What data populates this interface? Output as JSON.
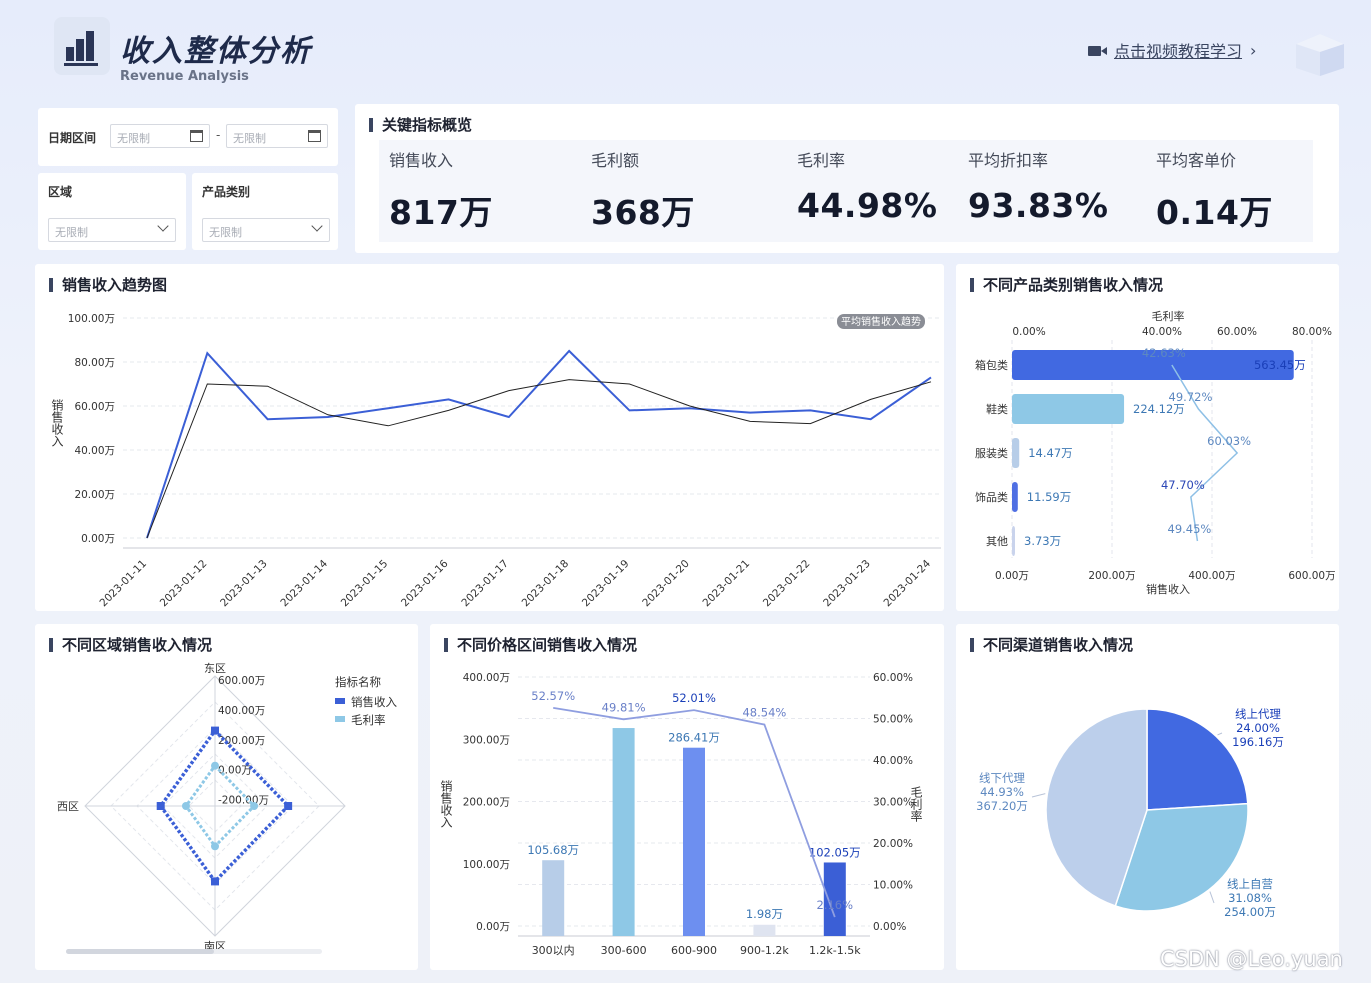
{
  "header": {
    "title": "收入整体分析",
    "subtitle": "Revenue Analysis",
    "tutorial_link": "点击视频教程学习",
    "watermark": "CSDN @Leo.yuan"
  },
  "filters": {
    "date_label": "日期区间",
    "date_start_placeholder": "无限制",
    "date_sep": "-",
    "date_end_placeholder": "无限制",
    "region_label": "区域",
    "region_value": "无限制",
    "category_label": "产品类别",
    "category_value": "无限制"
  },
  "kpi": {
    "title": "关键指标概览",
    "items": [
      {
        "label": "销售收入",
        "value": "817万"
      },
      {
        "label": "毛利额",
        "value": "368万"
      },
      {
        "label": "毛利率",
        "value": "44.98%"
      },
      {
        "label": "平均折扣率",
        "value": "93.83%"
      },
      {
        "label": "平均客单价",
        "value": "0.14万"
      }
    ]
  },
  "panels": {
    "trend_title": "销售收入趋势图",
    "category_title": "不同产品类别销售收入情况",
    "region_title": "不同区域销售收入情况",
    "price_title": "不同价格区间销售收入情况",
    "channel_title": "不同渠道销售收入情况"
  },
  "chart_data": [
    {
      "type": "line",
      "ylabel": "销售收入",
      "ylim": [
        0,
        100
      ],
      "y_ticks": [
        "0.00万",
        "20.00万",
        "40.00万",
        "60.00万",
        "80.00万",
        "100.00万"
      ],
      "x": [
        "2023-01-11",
        "2023-01-12",
        "2023-01-13",
        "2023-01-14",
        "2023-01-15",
        "2023-01-16",
        "2023-01-17",
        "2023-01-18",
        "2023-01-19",
        "2023-01-20",
        "2023-01-21",
        "2023-01-22",
        "2023-01-23",
        "2023-01-24"
      ],
      "series": [
        {
          "values": [
            0,
            84,
            54,
            55,
            59,
            63,
            55,
            85,
            58,
            59,
            57,
            58,
            54,
            73
          ],
          "color": "#3b5fd6"
        },
        {
          "values": [
            0,
            70,
            69,
            56,
            51,
            58,
            67,
            72,
            70,
            60,
            53,
            52,
            63,
            71
          ],
          "color": "#222222"
        }
      ],
      "badge": "平均销售收入趋势",
      "grid": true
    },
    {
      "type": "bar",
      "orientation": "horizontal",
      "categories": [
        "箱包类",
        "鞋类",
        "服装类",
        "饰品类",
        "其他"
      ],
      "bar_labels": [
        "563.45万",
        "224.12万",
        "14.47万",
        "11.59万",
        "3.73万"
      ],
      "values": [
        563.45,
        224.12,
        14.47,
        11.59,
        3.73
      ],
      "bar_colors": [
        "#4169e1",
        "#8ec8e6",
        "#b7cde8",
        "#4f6fe3",
        "#c9d3ec"
      ],
      "xlabel": "销售收入",
      "x_ticks": [
        "0.00万",
        "200.00万",
        "400.00万",
        "600.00万"
      ],
      "xlim": [
        0,
        600
      ],
      "secondary_label": "毛利率",
      "secondary_ticks": [
        "0.00%",
        "40.00%",
        "60.00%",
        "80.00%"
      ],
      "secondary_lim": [
        0,
        80
      ],
      "rate_values": [
        42.63,
        49.72,
        60.03,
        47.7,
        49.45
      ],
      "rate_labels": [
        "42.63%",
        "49.72%",
        "60.03%",
        "47.70%",
        "49.45%"
      ]
    },
    {
      "type": "radar",
      "axes": [
        "东区",
        "南区",
        "西区",
        ""
      ],
      "ring_labels": [
        "600.00万",
        "400.00万",
        "200.00万",
        "0.00万",
        "-200.00万"
      ],
      "legend_title": "指标名称",
      "series": [
        {
          "name": "销售收入",
          "color": "#3b5fd6"
        },
        {
          "name": "毛利率",
          "color": "#8ec8e6"
        }
      ]
    },
    {
      "type": "bar",
      "categories": [
        "300以内",
        "300-600",
        "600-900",
        "900-1.2k",
        "1.2k-1.5k"
      ],
      "values": [
        105.68,
        318,
        286.41,
        1.98,
        102.05
      ],
      "bar_labels": [
        "105.68万",
        "",
        "286.41万",
        "1.98万",
        "102.05万"
      ],
      "bar_colors": [
        "#b7cde8",
        "#8ec8e6",
        "#6d8ff0",
        "#dfe4f0",
        "#3b5fd6"
      ],
      "ylabel": "销售收入",
      "ylim": [
        0,
        400
      ],
      "y_ticks": [
        "0.00万",
        "100.00万",
        "200.00万",
        "300.00万",
        "400.00万"
      ],
      "secondary_label": "毛利率",
      "secondary_lim": [
        0,
        60
      ],
      "secondary_ticks": [
        "0.00%",
        "10.00%",
        "20.00%",
        "30.00%",
        "40.00%",
        "50.00%",
        "60.00%"
      ],
      "rate_values": [
        52.57,
        49.81,
        52.01,
        48.54,
        2.16
      ],
      "rate_labels": [
        "52.57%",
        "49.81%",
        "52.01%",
        "48.54%",
        "2.16%"
      ]
    },
    {
      "type": "pie",
      "slices": [
        {
          "name": "线上代理",
          "value": 196.16,
          "pct": "24.00%",
          "label": "196.16万",
          "color": "#4169e1"
        },
        {
          "name": "线上自营",
          "value": 254.0,
          "pct": "31.08%",
          "label": "254.00万",
          "color": "#8ec8e6"
        },
        {
          "name": "线下代理",
          "value": 367.2,
          "pct": "44.93%",
          "label": "367.20万",
          "color": "#bccfeb"
        }
      ]
    }
  ]
}
